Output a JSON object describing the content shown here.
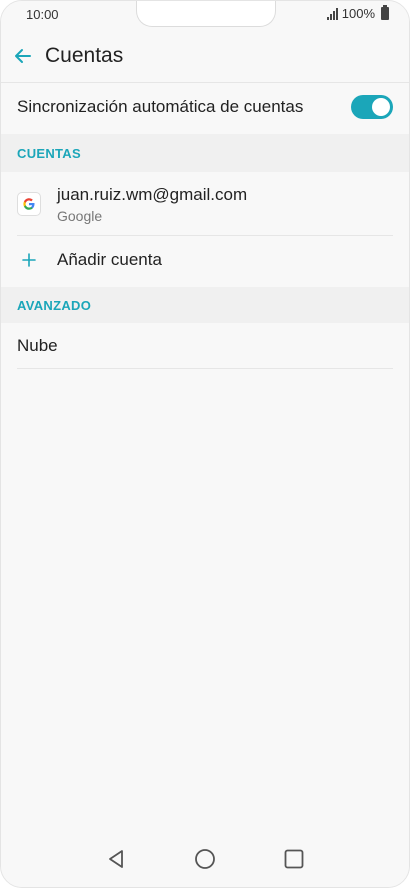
{
  "status_bar": {
    "time": "10:00",
    "battery_percent": "100%"
  },
  "header": {
    "back_icon": "arrow-left-icon",
    "title": "Cuentas"
  },
  "sync": {
    "label": "Sincronización automática de cuentas",
    "enabled": true
  },
  "sections": {
    "accounts_header": "CUENTAS",
    "advanced_header": "AVANZADO"
  },
  "accounts": [
    {
      "email": "juan.ruiz.wm@gmail.com",
      "type": "Google",
      "icon": "google-icon"
    }
  ],
  "add_account": {
    "label": "Añadir cuenta",
    "icon": "plus-icon"
  },
  "advanced": {
    "cloud_label": "Nube"
  },
  "nav": {
    "back": "triangle-back-icon",
    "home": "circle-home-icon",
    "recents": "square-recents-icon"
  },
  "colors": {
    "accent": "#1ba6b9",
    "background": "#f8f8f8",
    "section_background": "#f0f0f0"
  }
}
